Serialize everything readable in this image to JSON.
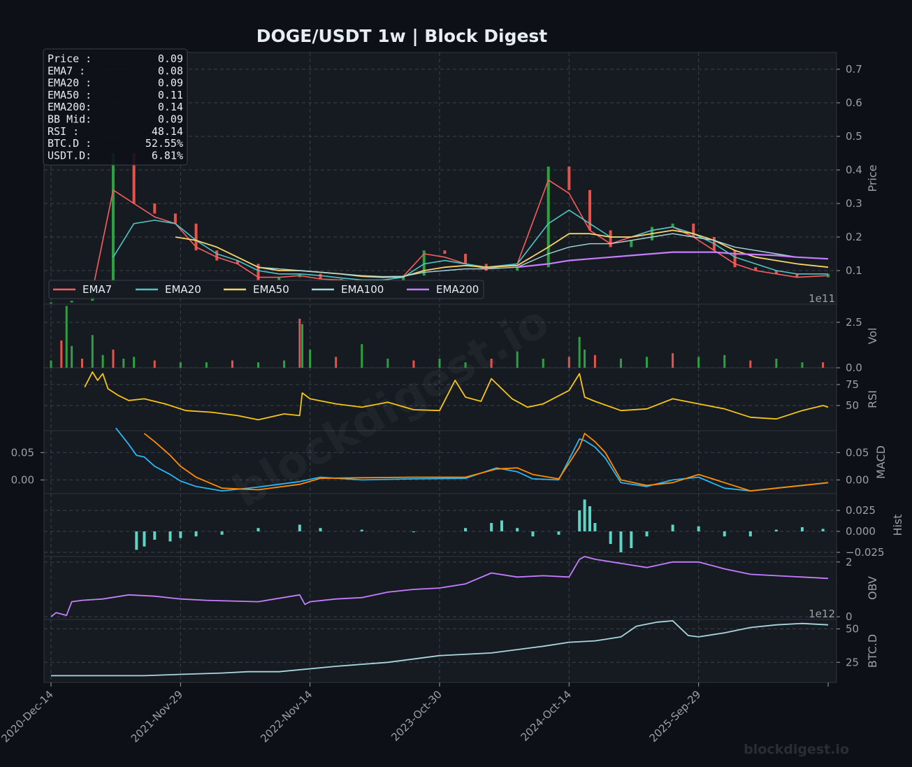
{
  "title": "DOGE/USDT  1w  |  Block Digest",
  "watermark_center": "blockdigest.io",
  "watermark_corner": "blockdigest.io",
  "colors": {
    "background": "#0d1117",
    "panel": "#161b22",
    "grid": "#3a414b",
    "axis_text": "#9aa0a8",
    "candle_up": "#2ea043",
    "candle_down": "#e5534b",
    "ema7": "#f85e5e",
    "ema20": "#4fc4c4",
    "ema50": "#f7d56a",
    "ema100": "#a9d8dc",
    "ema200": "#c77dff",
    "rsi": "#f5c518",
    "macd": "#29b6f6",
    "signal": "#ff8c00",
    "hist": "#5fd3c4",
    "obv": "#c77dff",
    "btcd": "#a9d8dc"
  },
  "info_box": [
    {
      "label": "Price :",
      "value": "0.09"
    },
    {
      "label": "EMA7  :",
      "value": "0.08"
    },
    {
      "label": "EMA20 :",
      "value": "0.09"
    },
    {
      "label": "EMA50 :",
      "value": "0.11"
    },
    {
      "label": "EMA200:",
      "value": "0.14"
    },
    {
      "label": "BB Mid:",
      "value": "0.09"
    },
    {
      "label": "RSI   :",
      "value": "48.14"
    },
    {
      "label": "BTC.D :",
      "value": "52.55%"
    },
    {
      "label": "USDT.D:",
      "value": "6.81%"
    }
  ],
  "legend": [
    "EMA7",
    "EMA20",
    "EMA50",
    "EMA100",
    "EMA200"
  ],
  "x_ticks": [
    "2020-Dec-14",
    "2021-Nov-29",
    "2022-Nov-14",
    "2023-Oct-30",
    "2024-Oct-14",
    "2025-Sep-29"
  ],
  "chart_data": [
    {
      "type": "line",
      "panel": "price",
      "ylabel": "Price",
      "ylim": [
        0.0,
        0.75
      ],
      "yticks": [
        "0.1",
        "0.2",
        "0.3",
        "0.4",
        "0.5",
        "0.6",
        "0.7"
      ],
      "offset_label": "1e11",
      "x": [
        0,
        8,
        16,
        24,
        32,
        40,
        48,
        56,
        64,
        72,
        80,
        88,
        96,
        104,
        112,
        120,
        128,
        136,
        144,
        152,
        160,
        168,
        180,
        192,
        200,
        208,
        216,
        224,
        232,
        240,
        248,
        256,
        264,
        272,
        280,
        288,
        300
      ],
      "series": [
        {
          "name": "Price",
          "values": [
            0.005,
            0.01,
            0.06,
            0.45,
            0.3,
            0.27,
            0.24,
            0.16,
            0.13,
            0.12,
            0.07,
            0.08,
            0.09,
            0.075,
            0.07,
            0.065,
            0.07,
            0.085,
            0.16,
            0.15,
            0.12,
            0.1,
            0.11,
            0.41,
            0.34,
            0.22,
            0.17,
            0.19,
            0.23,
            0.24,
            0.2,
            0.16,
            0.11,
            0.1,
            0.09,
            0.08,
            0.09
          ]
        },
        {
          "name": "EMA7",
          "values": [
            null,
            null,
            0.04,
            0.34,
            0.3,
            0.26,
            0.24,
            0.17,
            0.14,
            0.12,
            0.08,
            0.08,
            0.085,
            0.075,
            0.072,
            0.067,
            0.07,
            0.083,
            0.15,
            0.14,
            0.12,
            0.105,
            0.12,
            0.37,
            0.33,
            0.22,
            0.18,
            0.2,
            0.22,
            0.23,
            0.2,
            0.16,
            0.12,
            0.1,
            0.09,
            0.08,
            0.085
          ]
        },
        {
          "name": "EMA20",
          "values": [
            null,
            null,
            null,
            0.14,
            0.24,
            0.25,
            0.24,
            0.19,
            0.15,
            0.13,
            0.1,
            0.09,
            0.09,
            0.085,
            0.078,
            0.072,
            0.072,
            0.08,
            0.12,
            0.13,
            0.12,
            0.11,
            0.12,
            0.24,
            0.28,
            0.24,
            0.2,
            0.2,
            0.22,
            0.23,
            0.21,
            0.18,
            0.14,
            0.12,
            0.1,
            0.09,
            0.09
          ]
        },
        {
          "name": "EMA50",
          "values": [
            null,
            null,
            null,
            null,
            null,
            null,
            0.2,
            0.19,
            0.17,
            0.14,
            0.11,
            0.1,
            0.1,
            0.095,
            0.09,
            0.083,
            0.08,
            0.082,
            0.1,
            0.11,
            0.115,
            0.11,
            0.115,
            0.17,
            0.21,
            0.21,
            0.2,
            0.2,
            0.21,
            0.22,
            0.21,
            0.19,
            0.16,
            0.14,
            0.13,
            0.12,
            0.11
          ]
        },
        {
          "name": "EMA100",
          "values": [
            null,
            null,
            null,
            null,
            null,
            null,
            null,
            null,
            null,
            null,
            0.11,
            0.105,
            0.1,
            0.095,
            0.09,
            0.085,
            0.082,
            0.083,
            0.095,
            0.1,
            0.105,
            0.105,
            0.11,
            0.15,
            0.17,
            0.18,
            0.18,
            0.19,
            0.2,
            0.21,
            0.2,
            0.19,
            0.17,
            0.16,
            0.15,
            0.14,
            0.135
          ]
        },
        {
          "name": "EMA200",
          "values": [
            null,
            null,
            null,
            null,
            null,
            null,
            null,
            null,
            null,
            null,
            null,
            null,
            null,
            null,
            null,
            null,
            null,
            null,
            null,
            null,
            null,
            null,
            0.11,
            0.12,
            0.13,
            0.135,
            0.14,
            0.145,
            0.15,
            0.155,
            0.155,
            0.155,
            0.15,
            0.148,
            0.145,
            0.14,
            0.135
          ]
        }
      ]
    },
    {
      "type": "bar",
      "panel": "volume",
      "ylabel": "Vol",
      "ylim": [
        0,
        3.5
      ],
      "yticks": [
        "0.0",
        "2.5"
      ],
      "x": [
        0,
        4,
        6,
        8,
        12,
        16,
        20,
        24,
        28,
        32,
        40,
        50,
        60,
        70,
        80,
        90,
        96,
        97,
        100,
        110,
        120,
        130,
        140,
        150,
        160,
        170,
        180,
        190,
        200,
        204,
        206,
        210,
        220,
        230,
        240,
        250,
        260,
        270,
        280,
        290,
        298
      ],
      "series": [
        {
          "name": "Volume",
          "values": [
            0.4,
            1.5,
            3.4,
            1.2,
            0.5,
            1.8,
            0.7,
            1.0,
            0.5,
            0.6,
            0.4,
            0.3,
            0.3,
            0.4,
            0.3,
            0.4,
            2.7,
            2.4,
            1.0,
            0.6,
            1.3,
            0.5,
            0.4,
            0.5,
            0.3,
            0.5,
            0.9,
            0.5,
            0.6,
            1.7,
            1.0,
            0.7,
            0.5,
            0.6,
            0.8,
            0.6,
            0.7,
            0.4,
            0.5,
            0.3,
            0.3
          ]
        }
      ]
    },
    {
      "type": "line",
      "panel": "rsi",
      "ylabel": "RSI",
      "ylim": [
        20,
        95
      ],
      "yticks": [
        "50",
        "75"
      ],
      "x": [
        13,
        16,
        18,
        20,
        22,
        26,
        30,
        36,
        44,
        52,
        62,
        72,
        80,
        90,
        96,
        97,
        100,
        110,
        120,
        130,
        140,
        150,
        156,
        160,
        166,
        170,
        178,
        184,
        190,
        200,
        204,
        206,
        210,
        220,
        230,
        240,
        250,
        260,
        270,
        280,
        290,
        298,
        300
      ],
      "series": [
        {
          "name": "RSI",
          "values": [
            72,
            90,
            80,
            88,
            70,
            62,
            56,
            58,
            52,
            44,
            42,
            38,
            33,
            40,
            38,
            65,
            58,
            52,
            48,
            54,
            45,
            44,
            80,
            60,
            55,
            82,
            58,
            48,
            52,
            68,
            88,
            60,
            55,
            44,
            46,
            58,
            52,
            46,
            36,
            34,
            44,
            50,
            48
          ]
        }
      ]
    },
    {
      "type": "line",
      "panel": "macd",
      "ylabel": "MACD",
      "ylim": [
        -0.025,
        0.09
      ],
      "yticks": [
        "0.00",
        "0.05"
      ],
      "left_yticks": [
        "0.00",
        "0.05"
      ],
      "x": [
        25,
        30,
        33,
        36,
        40,
        46,
        50,
        56,
        66,
        80,
        96,
        104,
        120,
        140,
        160,
        172,
        180,
        186,
        196,
        204,
        206,
        210,
        214,
        220,
        230,
        240,
        250,
        260,
        270,
        280,
        290,
        300
      ],
      "series": [
        {
          "name": "MACD",
          "values": [
            0.095,
            0.065,
            0.045,
            0.042,
            0.025,
            0.01,
            -0.002,
            -0.012,
            -0.02,
            -0.013,
            -0.003,
            0.005,
            0.0,
            0.002,
            0.003,
            0.022,
            0.015,
            0.002,
            0.0,
            0.075,
            0.072,
            0.06,
            0.04,
            -0.005,
            -0.012,
            0.0,
            0.005,
            -0.015,
            -0.02,
            -0.015,
            -0.01,
            -0.005
          ]
        },
        {
          "name": "Signal",
          "values": [
            null,
            null,
            null,
            0.085,
            0.07,
            0.045,
            0.025,
            0.005,
            -0.015,
            -0.018,
            -0.008,
            0.003,
            0.004,
            0.005,
            0.005,
            0.02,
            0.022,
            0.01,
            0.002,
            0.06,
            0.085,
            0.07,
            0.05,
            0.0,
            -0.01,
            -0.005,
            0.01,
            -0.005,
            -0.02,
            -0.015,
            -0.01,
            -0.005
          ]
        }
      ]
    },
    {
      "type": "bar",
      "panel": "hist",
      "ylabel": "Hist",
      "ylim": [
        -0.03,
        0.045
      ],
      "yticks": [
        "−0.025",
        "0.000",
        "0.025"
      ],
      "x": [
        33,
        36,
        40,
        46,
        50,
        56,
        66,
        80,
        96,
        104,
        120,
        140,
        160,
        170,
        174,
        180,
        186,
        196,
        204,
        206,
        208,
        210,
        216,
        220,
        224,
        230,
        240,
        250,
        260,
        270,
        280,
        290,
        298
      ],
      "series": [
        {
          "name": "Histogram",
          "values": [
            -0.022,
            -0.018,
            -0.01,
            -0.012,
            -0.008,
            -0.006,
            -0.004,
            0.004,
            0.008,
            0.004,
            0.002,
            -0.001,
            0.004,
            0.01,
            0.013,
            0.004,
            -0.006,
            -0.004,
            0.025,
            0.038,
            0.03,
            0.01,
            -0.015,
            -0.025,
            -0.02,
            -0.006,
            0.008,
            0.006,
            -0.006,
            -0.006,
            0.002,
            0.005,
            0.003
          ]
        }
      ]
    },
    {
      "type": "line",
      "panel": "obv",
      "ylabel": "OBV",
      "ylim": [
        -0.1,
        2.2
      ],
      "yticks": [
        "0",
        "2"
      ],
      "offset_label": "1e12",
      "x": [
        0,
        2,
        6,
        8,
        12,
        20,
        30,
        40,
        50,
        60,
        80,
        96,
        98,
        100,
        110,
        120,
        130,
        140,
        150,
        160,
        170,
        180,
        190,
        200,
        204,
        206,
        210,
        220,
        230,
        240,
        250,
        260,
        270,
        280,
        290,
        300
      ],
      "series": [
        {
          "name": "OBV",
          "values": [
            0.0,
            0.15,
            0.05,
            0.55,
            0.6,
            0.65,
            0.8,
            0.75,
            0.65,
            0.6,
            0.55,
            0.8,
            0.45,
            0.55,
            0.65,
            0.7,
            0.9,
            1.0,
            1.05,
            1.2,
            1.6,
            1.45,
            1.5,
            1.45,
            2.1,
            2.2,
            2.1,
            1.95,
            1.8,
            2.0,
            2.0,
            1.75,
            1.55,
            1.5,
            1.45,
            1.4
          ]
        }
      ]
    },
    {
      "type": "line",
      "panel": "btcd",
      "ylabel": "BTC.D",
      "ylim": [
        10,
        57
      ],
      "yticks": [
        "25",
        "50"
      ],
      "x": [
        0,
        20,
        28,
        36,
        50,
        66,
        76,
        88,
        110,
        130,
        150,
        170,
        190,
        200,
        210,
        220,
        226,
        234,
        240,
        246,
        250,
        260,
        270,
        280,
        290,
        300
      ],
      "series": [
        {
          "name": "BTC.D",
          "values": [
            15,
            15,
            15,
            15,
            16,
            17,
            18,
            18,
            22,
            25,
            30,
            32,
            37,
            40,
            41,
            44,
            52,
            55,
            56,
            45,
            44,
            47,
            51,
            53,
            54,
            53
          ]
        }
      ]
    }
  ]
}
